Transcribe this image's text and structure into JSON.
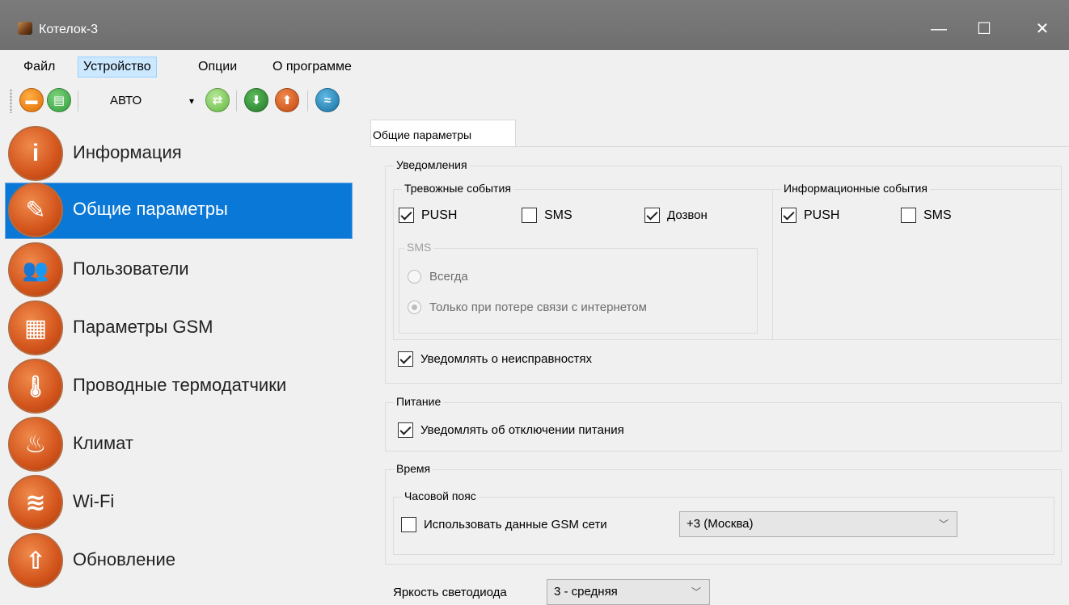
{
  "window": {
    "title": "Котелок-3",
    "controls": {
      "minimize": "—",
      "maximize": "☐",
      "close": "✕"
    }
  },
  "menu": {
    "items": [
      {
        "label": "Файл"
      },
      {
        "label": "Устройство"
      },
      {
        "label": "Опции"
      },
      {
        "label": "О программе"
      }
    ],
    "active": "Устройство"
  },
  "toolbar": {
    "mode_value": "АВТО",
    "combo_arrow": "▾",
    "buttons": {
      "open": "▬",
      "save": "▤",
      "connect": "⇄",
      "download": "⬇",
      "upload": "⬆",
      "sync": "≈"
    }
  },
  "sidebar": {
    "items": [
      {
        "label": "Информация",
        "icon": "info-icon",
        "glyph": "i"
      },
      {
        "label": "Общие параметры",
        "icon": "wrench-icon",
        "glyph": "✎"
      },
      {
        "label": "Пользователи",
        "icon": "users-icon",
        "glyph": "👥"
      },
      {
        "label": "Параметры GSM",
        "icon": "sim-card-icon",
        "glyph": "▦"
      },
      {
        "label": "Проводные термодатчики",
        "icon": "thermometer-icon",
        "glyph": "🌡"
      },
      {
        "label": "Климат",
        "icon": "flame-icon",
        "glyph": "♨"
      },
      {
        "label": "Wi-Fi",
        "icon": "wifi-icon",
        "glyph": "≋"
      },
      {
        "label": "Обновление",
        "icon": "update-arrow-icon",
        "glyph": "⇧"
      }
    ],
    "selected": "Общие параметры"
  },
  "tab": {
    "label": "Общие параметры"
  },
  "notifications": {
    "title": "Уведомления",
    "alarm": {
      "title": "Тревожные события",
      "push": {
        "label": "PUSH",
        "checked": true
      },
      "sms": {
        "label": "SMS",
        "checked": false
      },
      "call": {
        "label": "Дозвон",
        "checked": true
      },
      "sms_group": {
        "title": "SMS",
        "always": {
          "label": "Всегда",
          "selected": false
        },
        "only_on_loss": {
          "label": "Только при потере связи с интернетом",
          "selected": true
        }
      }
    },
    "info": {
      "title": "Информационные события",
      "push": {
        "label": "PUSH",
        "checked": true
      },
      "sms": {
        "label": "SMS",
        "checked": false
      }
    },
    "faults": {
      "label": "Уведомлять о неисправностях",
      "checked": true
    }
  },
  "power": {
    "title": "Питание",
    "notify_off": {
      "label": "Уведомлять об отключении питания",
      "checked": true
    }
  },
  "time": {
    "title": "Время",
    "timezone": {
      "title": "Часовой пояс",
      "use_gsm": {
        "label": "Использовать данные GSM сети",
        "checked": false
      },
      "value": "+3 (Москва)"
    }
  },
  "led": {
    "label": "Яркость светодиода",
    "value": "3 - средняя"
  },
  "colors": {
    "titlebar": "#737373",
    "selection": "#0a78d7",
    "nav_icon": "#d3551c"
  }
}
